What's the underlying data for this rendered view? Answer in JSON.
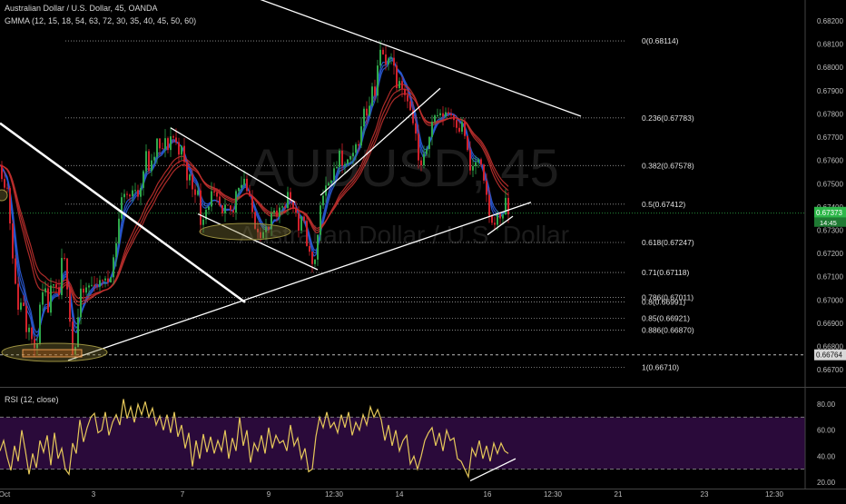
{
  "header": {
    "title": "Australian Dollar / U.S. Dollar, 45, OANDA",
    "indicator": "GMMA (12, 15, 18, 54, 63, 72, 30, 35, 40, 45, 50, 60)",
    "rsi_label": "RSI (12, close)"
  },
  "watermark": {
    "symbol": "AUDUSD, 45",
    "name": "Australian Dollar / U.S. Dollar"
  },
  "colors": {
    "background": "#000000",
    "candle_up": "#2ea84a",
    "candle_down": "#d1212b",
    "gmma_short": "#2a5bd7",
    "gmma_long": "#c0302e",
    "rsi_line": "#e6c85a",
    "rsi_band": "#2a0a3a",
    "current_price_bg": "#2eb84a",
    "fib_line": "#9a9a9a",
    "trendline": "#ffffff"
  },
  "chart_data": [
    {
      "type": "candlestick",
      "title": "Australian Dollar / U.S. Dollar, 45, OANDA",
      "ylim": [
        0.6663,
        0.6829
      ],
      "y_ticks": [
        "0.68200",
        "0.68100",
        "0.68000",
        "0.67900",
        "0.67800",
        "0.67700",
        "0.67600",
        "0.67500",
        "0.67400",
        "0.67300",
        "0.67200",
        "0.67100",
        "0.67000",
        "0.66900",
        "0.66800",
        "0.66700"
      ],
      "x_ticks": [
        "Oct",
        "3",
        "7",
        "9",
        "12:30",
        "14",
        "16",
        "12:30",
        "21",
        "23",
        "12:30"
      ],
      "current_price": {
        "value": 0.67373,
        "label": "0.67373",
        "countdown": "14:45"
      },
      "marked_price": {
        "value": 0.66764,
        "label": "0.66764"
      },
      "fibonacci": [
        {
          "label": "0(0.68114)",
          "value": 0.68114
        },
        {
          "label": "0.236(0.67783)",
          "value": 0.67783
        },
        {
          "label": "0.382(0.67578)",
          "value": 0.67578
        },
        {
          "label": "0.5(0.67412)",
          "value": 0.67412
        },
        {
          "label": "0.618(0.67247)",
          "value": 0.67247
        },
        {
          "label": "0.71(0.67118)",
          "value": 0.67118
        },
        {
          "label": "0.786(0.67011)",
          "value": 0.67011
        },
        {
          "label": "0.8(0.66991)",
          "value": 0.66991
        },
        {
          "label": "0.85(0.66921)",
          "value": 0.66921
        },
        {
          "label": "0.886(0.66870)",
          "value": 0.6687
        },
        {
          "label": "1(0.66710)",
          "value": 0.6671
        }
      ],
      "price_path": [
        [
          0,
          0.6758
        ],
        [
          4,
          0.6752
        ],
        [
          8,
          0.6748
        ],
        [
          13,
          0.6725
        ],
        [
          17,
          0.6705
        ],
        [
          21,
          0.6695
        ],
        [
          25,
          0.6702
        ],
        [
          29,
          0.6688
        ],
        [
          33,
          0.6692
        ],
        [
          37,
          0.6674
        ],
        [
          41,
          0.6684
        ],
        [
          45,
          0.6699
        ],
        [
          49,
          0.6704
        ],
        [
          53,
          0.6696
        ],
        [
          57,
          0.6706
        ],
        [
          61,
          0.6703
        ],
        [
          65,
          0.6702
        ],
        [
          69,
          0.672
        ],
        [
          73,
          0.6712
        ],
        [
          77,
          0.6693
        ],
        [
          81,
          0.6672
        ],
        [
          85,
          0.6689
        ],
        [
          89,
          0.6702
        ],
        [
          93,
          0.6703
        ],
        [
          97,
          0.6706
        ],
        [
          101,
          0.6706
        ],
        [
          105,
          0.6709
        ],
        [
          109,
          0.6705
        ],
        [
          113,
          0.671
        ],
        [
          117,
          0.6706
        ],
        [
          121,
          0.6711
        ],
        [
          125,
          0.6718
        ],
        [
          129,
          0.6728
        ],
        [
          133,
          0.6742
        ],
        [
          137,
          0.6747
        ],
        [
          141,
          0.6745
        ],
        [
          145,
          0.6744
        ],
        [
          149,
          0.6749
        ],
        [
          153,
          0.6746
        ],
        [
          157,
          0.6754
        ],
        [
          161,
          0.6762
        ],
        [
          165,
          0.6755
        ],
        [
          169,
          0.676
        ],
        [
          173,
          0.6768
        ],
        [
          177,
          0.6762
        ],
        [
          181,
          0.6768
        ],
        [
          185,
          0.6766
        ],
        [
          189,
          0.6772
        ],
        [
          193,
          0.6768
        ],
        [
          197,
          0.6765
        ],
        [
          201,
          0.6764
        ],
        [
          205,
          0.6752
        ],
        [
          209,
          0.6753
        ],
        [
          213,
          0.6747
        ],
        [
          217,
          0.6749
        ],
        [
          221,
          0.6734
        ],
        [
          225,
          0.6738
        ],
        [
          229,
          0.6741
        ],
        [
          233,
          0.6745
        ],
        [
          237,
          0.6743
        ],
        [
          241,
          0.6741
        ],
        [
          245,
          0.6735
        ],
        [
          249,
          0.6739
        ],
        [
          253,
          0.6739
        ],
        [
          257,
          0.6737
        ],
        [
          261,
          0.6752
        ],
        [
          265,
          0.6749
        ],
        [
          269,
          0.6753
        ],
        [
          273,
          0.6745
        ],
        [
          277,
          0.6739
        ],
        [
          281,
          0.6733
        ],
        [
          285,
          0.6731
        ],
        [
          289,
          0.6728
        ],
        [
          293,
          0.673
        ],
        [
          297,
          0.673
        ],
        [
          301,
          0.6739
        ],
        [
          305,
          0.6733
        ],
        [
          309,
          0.6742
        ],
        [
          313,
          0.6741
        ],
        [
          317,
          0.6745
        ],
        [
          321,
          0.6743
        ],
        [
          325,
          0.674
        ],
        [
          329,
          0.673
        ],
        [
          333,
          0.6735
        ],
        [
          337,
          0.6728
        ],
        [
          341,
          0.6719
        ],
        [
          345,
          0.6713
        ],
        [
          349,
          0.6723
        ],
        [
          353,
          0.6742
        ],
        [
          357,
          0.6743
        ],
        [
          361,
          0.6752
        ],
        [
          365,
          0.6754
        ],
        [
          369,
          0.6754
        ],
        [
          373,
          0.6763
        ],
        [
          377,
          0.6756
        ],
        [
          381,
          0.676
        ],
        [
          385,
          0.6759
        ],
        [
          389,
          0.6761
        ],
        [
          393,
          0.6768
        ],
        [
          397,
          0.677
        ],
        [
          401,
          0.6783
        ],
        [
          405,
          0.678
        ],
        [
          409,
          0.6792
        ],
        [
          413,
          0.679
        ],
        [
          417,
          0.6805
        ],
        [
          421,
          0.6807
        ],
        [
          425,
          0.68
        ],
        [
          429,
          0.6808
        ],
        [
          433,
          0.6802
        ],
        [
          437,
          0.6794
        ],
        [
          441,
          0.6797
        ],
        [
          445,
          0.6789
        ],
        [
          449,
          0.6788
        ],
        [
          453,
          0.6778
        ],
        [
          457,
          0.6774
        ],
        [
          461,
          0.6759
        ],
        [
          465,
          0.6756
        ],
        [
          469,
          0.6764
        ],
        [
          473,
          0.6773
        ],
        [
          477,
          0.6777
        ],
        [
          481,
          0.6781
        ],
        [
          485,
          0.6778
        ],
        [
          489,
          0.6781
        ],
        [
          493,
          0.6781
        ],
        [
          497,
          0.678
        ],
        [
          501,
          0.6779
        ],
        [
          505,
          0.6774
        ],
        [
          509,
          0.6775
        ],
        [
          513,
          0.677
        ],
        [
          517,
          0.6755
        ],
        [
          521,
          0.6757
        ],
        [
          525,
          0.676
        ],
        [
          529,
          0.6758
        ],
        [
          533,
          0.6749
        ],
        [
          537,
          0.6743
        ],
        [
          541,
          0.6731
        ],
        [
          545,
          0.6735
        ],
        [
          549,
          0.6735
        ],
        [
          553,
          0.6737
        ],
        [
          557,
          0.6741
        ],
        [
          561,
          0.6736
        ]
      ],
      "annotations": [
        {
          "kind": "trendline",
          "from": [
            0,
            0.6776
          ],
          "to": [
            270,
            0.6699
          ]
        },
        {
          "kind": "trendline",
          "from": [
            75,
            0.6674
          ],
          "to": [
            585,
            0.6742
          ]
        },
        {
          "kind": "trendline",
          "from": [
            190,
            0.6843
          ],
          "to": [
            640,
            0.6779
          ]
        },
        {
          "kind": "trendline",
          "from": [
            188,
            0.6774
          ],
          "to": [
            325,
            0.6742
          ]
        },
        {
          "kind": "trendline",
          "from": [
            218,
            0.6737
          ],
          "to": [
            350,
            0.6713
          ]
        },
        {
          "kind": "trendline",
          "from": [
            353,
            0.6745
          ],
          "to": [
            485,
            0.6791
          ]
        },
        {
          "kind": "trendline",
          "from": [
            537,
            0.6728
          ],
          "to": [
            565,
            0.6736
          ]
        }
      ]
    },
    {
      "type": "line",
      "title": "RSI (12, close)",
      "ylim": [
        15,
        92
      ],
      "y_ticks": [
        "80.00",
        "60.00",
        "40.00",
        "20.00"
      ],
      "bands": [
        30,
        70
      ],
      "values": [
        [
          0,
          44
        ],
        [
          4,
          52
        ],
        [
          8,
          39
        ],
        [
          12,
          29
        ],
        [
          16,
          48
        ],
        [
          20,
          36
        ],
        [
          24,
          60
        ],
        [
          28,
          44
        ],
        [
          32,
          26
        ],
        [
          36,
          42
        ],
        [
          40,
          31
        ],
        [
          44,
          52
        ],
        [
          48,
          43
        ],
        [
          52,
          56
        ],
        [
          56,
          33
        ],
        [
          60,
          58
        ],
        [
          64,
          38
        ],
        [
          68,
          46
        ],
        [
          72,
          30
        ],
        [
          76,
          26
        ],
        [
          80,
          50
        ],
        [
          84,
          42
        ],
        [
          88,
          68
        ],
        [
          92,
          51
        ],
        [
          96,
          62
        ],
        [
          100,
          70
        ],
        [
          104,
          73
        ],
        [
          108,
          58
        ],
        [
          112,
          60
        ],
        [
          116,
          74
        ],
        [
          120,
          56
        ],
        [
          124,
          66
        ],
        [
          128,
          72
        ],
        [
          132,
          64
        ],
        [
          136,
          84
        ],
        [
          140,
          69
        ],
        [
          144,
          78
        ],
        [
          148,
          66
        ],
        [
          152,
          80
        ],
        [
          156,
          72
        ],
        [
          160,
          82
        ],
        [
          164,
          70
        ],
        [
          168,
          77
        ],
        [
          172,
          64
        ],
        [
          176,
          71
        ],
        [
          180,
          60
        ],
        [
          184,
          72
        ],
        [
          188,
          58
        ],
        [
          192,
          74
        ],
        [
          196,
          55
        ],
        [
          200,
          64
        ],
        [
          204,
          46
        ],
        [
          208,
          58
        ],
        [
          212,
          32
        ],
        [
          216,
          52
        ],
        [
          220,
          38
        ],
        [
          224,
          57
        ],
        [
          228,
          43
        ],
        [
          232,
          55
        ],
        [
          236,
          42
        ],
        [
          240,
          52
        ],
        [
          244,
          44
        ],
        [
          248,
          60
        ],
        [
          252,
          38
        ],
        [
          256,
          54
        ],
        [
          260,
          44
        ],
        [
          264,
          70
        ],
        [
          268,
          48
        ],
        [
          272,
          60
        ],
        [
          276,
          35
        ],
        [
          280,
          50
        ],
        [
          284,
          44
        ],
        [
          288,
          56
        ],
        [
          292,
          42
        ],
        [
          296,
          62
        ],
        [
          300,
          46
        ],
        [
          304,
          56
        ],
        [
          308,
          50
        ],
        [
          312,
          52
        ],
        [
          316,
          44
        ],
        [
          320,
          64
        ],
        [
          324,
          48
        ],
        [
          328,
          54
        ],
        [
          332,
          38
        ],
        [
          336,
          46
        ],
        [
          340,
          28
        ],
        [
          344,
          30
        ],
        [
          348,
          55
        ],
        [
          352,
          70
        ],
        [
          356,
          62
        ],
        [
          360,
          74
        ],
        [
          364,
          62
        ],
        [
          368,
          66
        ],
        [
          372,
          58
        ],
        [
          376,
          72
        ],
        [
          380,
          62
        ],
        [
          384,
          74
        ],
        [
          388,
          56
        ],
        [
          392,
          66
        ],
        [
          396,
          60
        ],
        [
          400,
          72
        ],
        [
          404,
          64
        ],
        [
          408,
          78
        ],
        [
          412,
          70
        ],
        [
          416,
          76
        ],
        [
          420,
          68
        ],
        [
          424,
          52
        ],
        [
          428,
          64
        ],
        [
          432,
          48
        ],
        [
          436,
          60
        ],
        [
          440,
          44
        ],
        [
          444,
          52
        ],
        [
          448,
          56
        ],
        [
          452,
          34
        ],
        [
          456,
          40
        ],
        [
          460,
          30
        ],
        [
          464,
          40
        ],
        [
          468,
          52
        ],
        [
          472,
          58
        ],
        [
          476,
          62
        ],
        [
          480,
          48
        ],
        [
          484,
          58
        ],
        [
          488,
          44
        ],
        [
          492,
          60
        ],
        [
          496,
          52
        ],
        [
          500,
          54
        ],
        [
          504,
          38
        ],
        [
          508,
          36
        ],
        [
          512,
          30
        ],
        [
          516,
          24
        ],
        [
          520,
          46
        ],
        [
          524,
          40
        ],
        [
          528,
          52
        ],
        [
          532,
          38
        ],
        [
          536,
          48
        ],
        [
          540,
          36
        ],
        [
          544,
          50
        ],
        [
          548,
          42
        ],
        [
          552,
          50
        ],
        [
          556,
          44
        ],
        [
          560,
          42
        ]
      ],
      "annotations": [
        {
          "kind": "trendline",
          "from": [
            518,
            21
          ],
          "to": [
            568,
            38
          ]
        }
      ]
    }
  ]
}
